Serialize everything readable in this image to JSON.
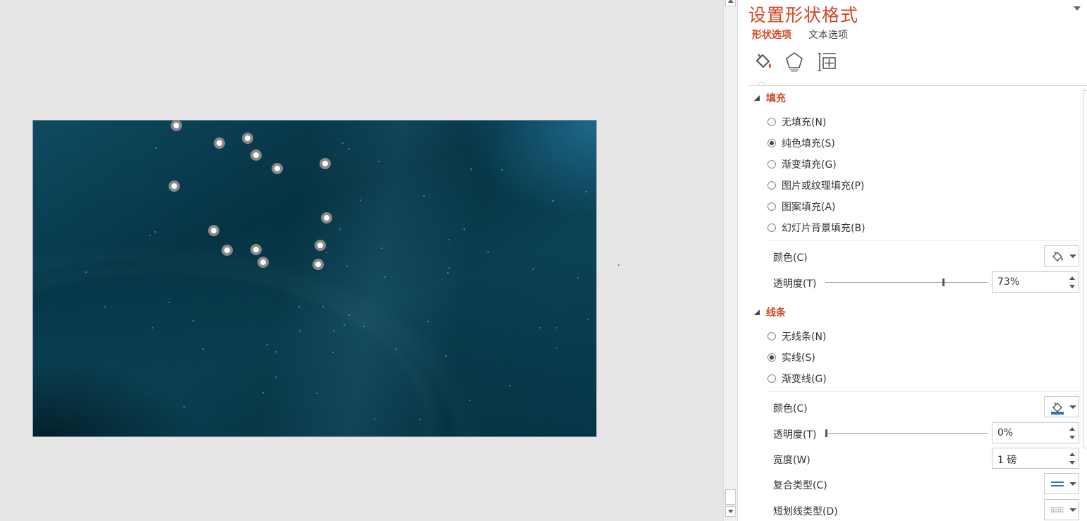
{
  "pane": {
    "title": "设置形状格式",
    "tabs": {
      "shape_options": "形状选项",
      "text_options": "文本选项"
    },
    "category_icons": [
      "fill-and-line-icon",
      "effects-icon",
      "size-and-properties-icon"
    ]
  },
  "fill": {
    "header": "填充",
    "options": [
      {
        "label": "无填充(N)",
        "selected": false
      },
      {
        "label": "纯色填充(S)",
        "selected": true
      },
      {
        "label": "渐变填充(G)",
        "selected": false
      },
      {
        "label": "图片或纹理填充(P)",
        "selected": false
      },
      {
        "label": "图案填充(A)",
        "selected": false
      },
      {
        "label": "幻灯片背景填充(B)",
        "selected": false
      }
    ],
    "color_label": "颜色(C)",
    "transparency_label": "透明度(T)",
    "transparency_value": "73%",
    "transparency_fraction": 0.73
  },
  "line": {
    "header": "线条",
    "options": [
      {
        "label": "无线条(N)",
        "selected": false
      },
      {
        "label": "实线(S)",
        "selected": true
      },
      {
        "label": "渐变线(G)",
        "selected": false
      }
    ],
    "color_label": "颜色(C)",
    "transparency_label": "透明度(T)",
    "transparency_value": "0%",
    "transparency_fraction": 0.0,
    "width_label": "宽度(W)",
    "width_value": "1 磅",
    "compound_label": "复合类型(C)",
    "dash_label": "短划线类型(D)"
  },
  "colors": {
    "accent": "#d24726",
    "slide_bg": "#06394b",
    "node_ring": "#8a8a8a",
    "node_center": "#ffffff",
    "line_color_swatch": "#2e75b6"
  }
}
